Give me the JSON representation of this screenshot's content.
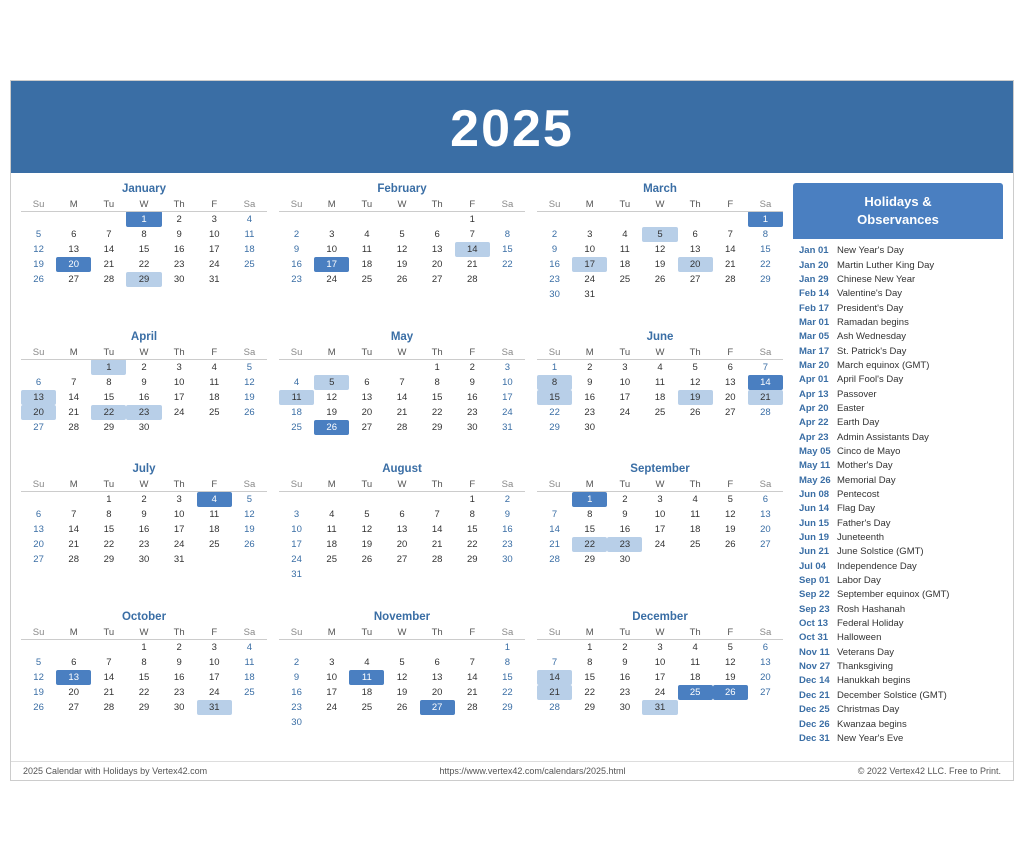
{
  "header": {
    "year": "2025"
  },
  "sidebar": {
    "title": "Holidays &\nObservances",
    "holidays": [
      {
        "date": "Jan 01",
        "name": "New Year's Day"
      },
      {
        "date": "Jan 20",
        "name": "Martin Luther King Day"
      },
      {
        "date": "Jan 29",
        "name": "Chinese New Year"
      },
      {
        "date": "Feb 14",
        "name": "Valentine's Day"
      },
      {
        "date": "Feb 17",
        "name": "President's Day"
      },
      {
        "date": "Mar 01",
        "name": "Ramadan begins"
      },
      {
        "date": "Mar 05",
        "name": "Ash Wednesday"
      },
      {
        "date": "Mar 17",
        "name": "St. Patrick's Day"
      },
      {
        "date": "Mar 20",
        "name": "March equinox (GMT)"
      },
      {
        "date": "Apr 01",
        "name": "April Fool's Day"
      },
      {
        "date": "Apr 13",
        "name": "Passover"
      },
      {
        "date": "Apr 20",
        "name": "Easter"
      },
      {
        "date": "Apr 22",
        "name": "Earth Day"
      },
      {
        "date": "Apr 23",
        "name": "Admin Assistants Day"
      },
      {
        "date": "May 05",
        "name": "Cinco de Mayo"
      },
      {
        "date": "May 11",
        "name": "Mother's Day"
      },
      {
        "date": "May 26",
        "name": "Memorial Day"
      },
      {
        "date": "Jun 08",
        "name": "Pentecost"
      },
      {
        "date": "Jun 14",
        "name": "Flag Day"
      },
      {
        "date": "Jun 15",
        "name": "Father's Day"
      },
      {
        "date": "Jun 19",
        "name": "Juneteenth"
      },
      {
        "date": "Jun 21",
        "name": "June Solstice (GMT)"
      },
      {
        "date": "Jul 04",
        "name": "Independence Day"
      },
      {
        "date": "Sep 01",
        "name": "Labor Day"
      },
      {
        "date": "Sep 22",
        "name": "September equinox (GMT)"
      },
      {
        "date": "Sep 23",
        "name": "Rosh Hashanah"
      },
      {
        "date": "Oct 13",
        "name": "Federal Holiday"
      },
      {
        "date": "Oct 31",
        "name": "Halloween"
      },
      {
        "date": "Nov 11",
        "name": "Veterans Day"
      },
      {
        "date": "Nov 27",
        "name": "Thanksgiving"
      },
      {
        "date": "Dec 14",
        "name": "Hanukkah begins"
      },
      {
        "date": "Dec 21",
        "name": "December Solstice (GMT)"
      },
      {
        "date": "Dec 25",
        "name": "Christmas Day"
      },
      {
        "date": "Dec 26",
        "name": "Kwanzaa begins"
      },
      {
        "date": "Dec 31",
        "name": "New Year's Eve"
      }
    ]
  },
  "footer": {
    "left": "2025 Calendar with Holidays by Vertex42.com",
    "center": "https://www.vertex42.com/calendars/2025.html",
    "right": "© 2022 Vertex42 LLC. Free to Print."
  },
  "months": [
    {
      "name": "January",
      "weeks": [
        [
          null,
          null,
          null,
          "1h",
          "2",
          "3",
          "4s"
        ],
        [
          "5",
          "6",
          "7",
          "8",
          "9",
          "10",
          "11s"
        ],
        [
          "12",
          "13",
          "14",
          "15",
          "16",
          "17",
          "18s"
        ],
        [
          "19",
          "20h",
          "21",
          "22",
          "23",
          "24",
          "25s"
        ],
        [
          "26",
          "27",
          "28",
          "29h",
          "30",
          "31",
          null
        ]
      ]
    },
    {
      "name": "February",
      "weeks": [
        [
          null,
          null,
          null,
          null,
          null,
          "1",
          null
        ],
        [
          "2",
          "3",
          "4",
          "5",
          "6",
          "7",
          "8s"
        ],
        [
          "9",
          "10",
          "11",
          "12",
          "13",
          "14h",
          "15s"
        ],
        [
          "16",
          "17h",
          "18",
          "19",
          "20",
          "21",
          "22s"
        ],
        [
          "23",
          "24",
          "25",
          "26",
          "27",
          "28",
          null
        ]
      ]
    },
    {
      "name": "March",
      "weeks": [
        [
          null,
          null,
          null,
          null,
          null,
          null,
          "1s"
        ],
        [
          "2",
          "3",
          "4",
          "5h",
          "6",
          "7",
          "8s"
        ],
        [
          "9",
          "10",
          "11",
          "12",
          "13",
          "14",
          "15s"
        ],
        [
          "16",
          "17h",
          "18",
          "19",
          "20h",
          "21",
          "22s"
        ],
        [
          "23",
          "24",
          "25",
          "26",
          "27",
          "28",
          "29s"
        ],
        [
          "30",
          "31",
          null,
          null,
          null,
          null,
          null
        ]
      ]
    },
    {
      "name": "April",
      "weeks": [
        [
          null,
          null,
          "1",
          "2",
          "3",
          "4",
          "5s"
        ],
        [
          "6",
          "7",
          "8",
          "9",
          "10",
          "11",
          "12s"
        ],
        [
          "13h",
          "14",
          "15",
          "16",
          "17",
          "18",
          "19s"
        ],
        [
          "20h",
          "21",
          "22h",
          "23h",
          "24",
          "25",
          "26s"
        ],
        [
          "27",
          "28",
          "29",
          "30",
          null,
          null,
          null
        ]
      ]
    },
    {
      "name": "May",
      "weeks": [
        [
          null,
          null,
          null,
          null,
          "1",
          "2",
          "3s"
        ],
        [
          "4",
          "5h",
          "6",
          "7",
          "8",
          "9",
          "10s"
        ],
        [
          "11h",
          "12",
          "13",
          "14",
          "15",
          "16",
          "17s"
        ],
        [
          "18",
          "19",
          "20",
          "21",
          "22",
          "23",
          "24s"
        ],
        [
          "25",
          "26h",
          "27",
          "28",
          "29",
          "30",
          "31s"
        ]
      ]
    },
    {
      "name": "June",
      "weeks": [
        [
          "1",
          "2",
          "3",
          "4",
          "5",
          "6",
          "7s"
        ],
        [
          "8h",
          "9",
          "10",
          "11",
          "12",
          "13",
          "14hs"
        ],
        [
          "15h",
          "16",
          "17",
          "18",
          "19h",
          "20",
          "21hs"
        ],
        [
          "22",
          "23",
          "24",
          "25",
          "26",
          "27",
          "28s"
        ],
        [
          "29",
          "30",
          null,
          null,
          null,
          null,
          null
        ]
      ]
    },
    {
      "name": "July",
      "weeks": [
        [
          null,
          null,
          "1",
          "2",
          "3",
          "4h",
          "5s"
        ],
        [
          "6",
          "7",
          "8",
          "9",
          "10",
          "11",
          "12s"
        ],
        [
          "13",
          "14",
          "15",
          "16",
          "17",
          "18",
          "19s"
        ],
        [
          "20",
          "21",
          "22",
          "23",
          "24",
          "25",
          "26s"
        ],
        [
          "27",
          "28",
          "29",
          "30",
          "31",
          null,
          null
        ]
      ]
    },
    {
      "name": "August",
      "weeks": [
        [
          null,
          null,
          null,
          null,
          null,
          "1",
          "2s"
        ],
        [
          "3",
          "4",
          "5",
          "6",
          "7",
          "8",
          "9s"
        ],
        [
          "10",
          "11",
          "12",
          "13",
          "14",
          "15",
          "16s"
        ],
        [
          "17",
          "18",
          "19",
          "20",
          "21",
          "22",
          "23s"
        ],
        [
          "24",
          "25",
          "26",
          "27",
          "28",
          "29",
          "30s"
        ],
        [
          "31",
          null,
          null,
          null,
          null,
          null,
          null
        ]
      ]
    },
    {
      "name": "September",
      "weeks": [
        [
          null,
          "1h",
          "2",
          "3",
          "4",
          "5",
          "6s"
        ],
        [
          "7",
          "8",
          "9",
          "10",
          "11",
          "12",
          "13s"
        ],
        [
          "14",
          "15",
          "16",
          "17",
          "18",
          "19",
          "20s"
        ],
        [
          "21",
          "22h",
          "23h",
          "24",
          "25",
          "26",
          "27s"
        ],
        [
          "28",
          "29",
          "30",
          null,
          null,
          null,
          null
        ]
      ]
    },
    {
      "name": "October",
      "weeks": [
        [
          null,
          null,
          null,
          "1",
          "2",
          "3",
          "4s"
        ],
        [
          "5",
          "6",
          "7",
          "8",
          "9",
          "10",
          "11s"
        ],
        [
          "12",
          "13h",
          "14",
          "15",
          "16",
          "17",
          "18s"
        ],
        [
          "19",
          "20",
          "21",
          "22",
          "23",
          "24",
          "25s"
        ],
        [
          "26",
          "27",
          "28",
          "29",
          "30",
          "31h",
          null
        ]
      ]
    },
    {
      "name": "November",
      "weeks": [
        [
          null,
          null,
          null,
          null,
          null,
          null,
          "1s"
        ],
        [
          "2",
          "3",
          "4",
          "5",
          "6",
          "7",
          "8s"
        ],
        [
          "9",
          "10",
          "11h",
          "12",
          "13",
          "14",
          "15s"
        ],
        [
          "16",
          "17",
          "18",
          "19",
          "20",
          "21",
          "22s"
        ],
        [
          "23",
          "24",
          "25",
          "26",
          "27h",
          "28",
          "29s"
        ],
        [
          "30",
          null,
          null,
          null,
          null,
          null,
          null
        ]
      ]
    },
    {
      "name": "December",
      "weeks": [
        [
          null,
          "1",
          "2",
          "3",
          "4",
          "5",
          "6s"
        ],
        [
          "7",
          "8",
          "9",
          "10",
          "11",
          "12",
          "13s"
        ],
        [
          "14h",
          "15",
          "16",
          "17",
          "18",
          "19",
          "20s"
        ],
        [
          "21h",
          "22",
          "23",
          "24",
          "25h",
          "26h",
          "27s"
        ],
        [
          "28",
          "29",
          "30",
          "31h",
          null,
          null,
          null
        ]
      ]
    }
  ]
}
